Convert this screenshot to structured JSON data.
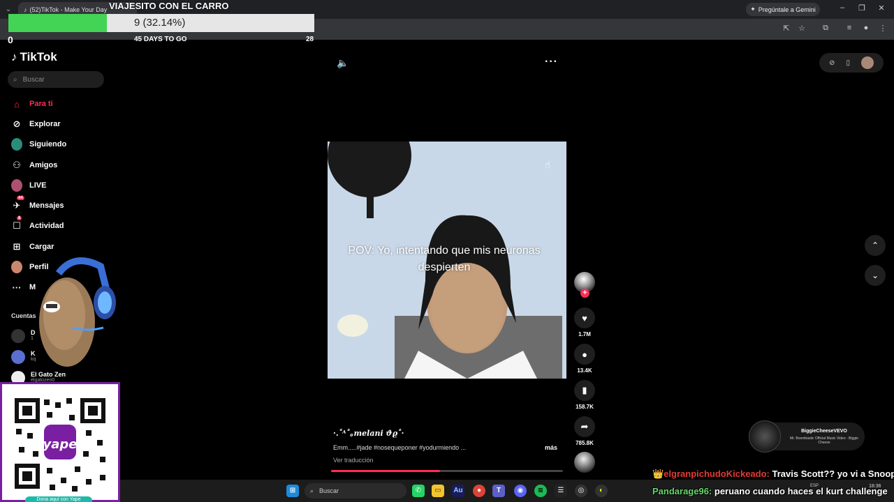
{
  "browser": {
    "tab_title": "(52)TikTok - Make Your Day",
    "gemini_button": "Pregúntale a Gemini"
  },
  "goal": {
    "title": "VIAJESITO CON EL CARRO",
    "progress_text": "9 (32.14%)",
    "progress_fraction": 0.3214,
    "min_label": "0",
    "days_label": "45 DAYS TO GO",
    "max_label": "28",
    "fill_color": "#43d455"
  },
  "tiktok": {
    "logo": "TikTok",
    "search_placeholder": "Buscar",
    "nav": [
      {
        "label": "Para ti",
        "icon": "home-icon",
        "active": true
      },
      {
        "label": "Explorar",
        "icon": "compass-icon"
      },
      {
        "label": "Siguiendo",
        "icon": "following-avatar-icon"
      },
      {
        "label": "Amigos",
        "icon": "friends-icon"
      },
      {
        "label": "LIVE",
        "icon": "live-icon"
      },
      {
        "label": "Mensajes",
        "icon": "messages-icon",
        "badge": "44"
      },
      {
        "label": "Actividad",
        "icon": "activity-icon",
        "badge": "8"
      },
      {
        "label": "Cargar",
        "icon": "upload-icon"
      },
      {
        "label": "Perfil",
        "icon": "profile-avatar-icon"
      },
      {
        "label": "M",
        "icon": "more-icon"
      }
    ],
    "accounts_heading": "Cuentas",
    "accounts": [
      {
        "name": "D",
        "user": "1"
      },
      {
        "name": "K",
        "user": "kq"
      },
      {
        "name": "El Gato Zen",
        "user": "elgatozen0"
      }
    ],
    "accent_color": "#fe2c55"
  },
  "video": {
    "caption": "POV: Yo, intentando que mis neuronas despierten",
    "author": "·.˚ᴬ˚｡melani ϑϱ˚·",
    "description": "Emm.....#jade #nosequeponer #yodurmiendo ...",
    "more_label": "más",
    "translate_label": "Ver traducción",
    "playback_fraction": 0.47,
    "likes": "1.7M",
    "comments": "13.4K",
    "saves": "158.7K",
    "shares": "785.8K"
  },
  "qr": {
    "label": "Dona aquí con Yape",
    "brand": "yape"
  },
  "now_playing": {
    "title": "BiggieCheeseVEVO",
    "subtitle": "Mr. Boombastic Official Music Video - Biggie Cheese"
  },
  "chat": [
    {
      "user": "👑elgranpichudoKickeado:",
      "message": " Travis Scott?? yo vi a Snoop"
    },
    {
      "user": "Pandarage96:",
      "message": " peruano cuando haces el kurt challenge"
    }
  ],
  "taskbar": {
    "search_placeholder": "Buscar",
    "tray_lang": "ESP",
    "clock": "18:36"
  }
}
